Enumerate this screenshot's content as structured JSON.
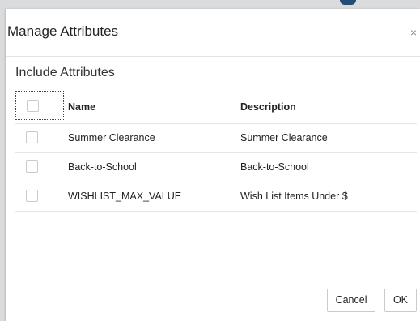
{
  "dialog": {
    "title": "Manage Attributes",
    "close_label": "×"
  },
  "section": {
    "title": "Include Attributes"
  },
  "table": {
    "headers": {
      "name": "Name",
      "description": "Description"
    },
    "rows": [
      {
        "name": "Summer Clearance",
        "description": "Summer Clearance",
        "checked": false
      },
      {
        "name": "Back-to-School",
        "description": "Back-to-School",
        "checked": false
      },
      {
        "name": "WISHLIST_MAX_VALUE",
        "description": "Wish List Items Under $",
        "checked": false
      }
    ]
  },
  "footer": {
    "cancel_label": "Cancel",
    "ok_label": "OK"
  }
}
